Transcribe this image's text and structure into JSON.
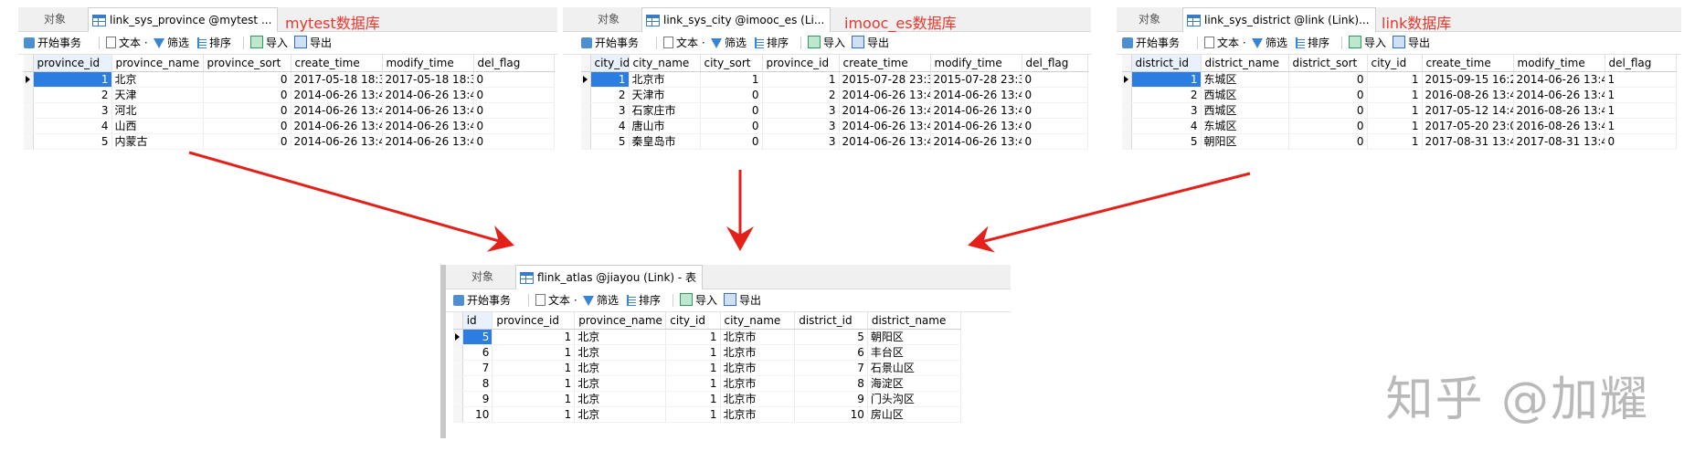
{
  "common": {
    "objects_tab": "对象",
    "toolbar": {
      "begin_tx": "开始事务",
      "text": "文本",
      "filter": "筛选",
      "sort": "排序",
      "import": "导入",
      "export": "导出"
    }
  },
  "watermark": "知乎 @加耀",
  "panels": [
    {
      "tab_title": "link_sys_province @mytest ...",
      "db_label": "mytest数据库",
      "columns": [
        "province_id",
        "province_name",
        "province_sort",
        "create_time",
        "modify_time",
        "del_flag"
      ],
      "rows": [
        [
          "1",
          "北京",
          "0",
          "2017-05-18 18:3(",
          "2017-05-18 18:3(",
          "0"
        ],
        [
          "2",
          "天津",
          "0",
          "2014-06-26 13:4",
          "2014-06-26 13:4",
          "0"
        ],
        [
          "3",
          "河北",
          "0",
          "2014-06-26 13:4",
          "2014-06-26 13:4",
          "0"
        ],
        [
          "4",
          "山西",
          "0",
          "2014-06-26 13:4",
          "2014-06-26 13:4",
          "0"
        ],
        [
          "5",
          "内蒙古",
          "0",
          "2014-06-26 13:4",
          "2014-06-26 13:4",
          "0"
        ]
      ]
    },
    {
      "tab_title": "link_sys_city @imooc_es (Li...",
      "db_label": "imooc_es数据库",
      "columns": [
        "city_id",
        "city_name",
        "city_sort",
        "province_id",
        "create_time",
        "modify_time",
        "del_flag"
      ],
      "rows": [
        [
          "1",
          "北京市",
          "1",
          "1",
          "2015-07-28 23:3",
          "2015-07-28 23:3",
          "0"
        ],
        [
          "2",
          "天津市",
          "0",
          "2",
          "2014-06-26 13:4",
          "2014-06-26 13:4",
          "0"
        ],
        [
          "3",
          "石家庄市",
          "0",
          "3",
          "2014-06-26 13:4",
          "2014-06-26 13:4",
          "0"
        ],
        [
          "4",
          "唐山市",
          "0",
          "3",
          "2014-06-26 13:4",
          "2014-06-26 13:4",
          "0"
        ],
        [
          "5",
          "秦皇岛市",
          "0",
          "3",
          "2014-06-26 13:4",
          "2014-06-26 13:4",
          "0"
        ]
      ]
    },
    {
      "tab_title": "link_sys_district @link (Link)...",
      "db_label": "link数据库",
      "columns": [
        "district_id",
        "district_name",
        "district_sort",
        "city_id",
        "create_time",
        "modify_time",
        "del_flag"
      ],
      "rows": [
        [
          "1",
          "东城区",
          "0",
          "1",
          "2015-09-15 16:2",
          "2014-06-26 13:4",
          "1"
        ],
        [
          "2",
          "西城区",
          "0",
          "1",
          "2016-08-26 13:4",
          "2014-06-26 13:4",
          "1"
        ],
        [
          "3",
          "西城区",
          "0",
          "1",
          "2017-05-12 14:4",
          "2016-08-26 13:4",
          "1"
        ],
        [
          "4",
          "东城区",
          "0",
          "1",
          "2017-05-20 23:0",
          "2016-08-26 13:4",
          "1"
        ],
        [
          "5",
          "朝阳区",
          "0",
          "1",
          "2017-08-31 13:4",
          "2017-08-31 13:4",
          "0"
        ]
      ]
    },
    {
      "tab_title": "flink_atlas @jiayou (Link) - 表",
      "db_label": "",
      "columns": [
        "id",
        "province_id",
        "province_name",
        "city_id",
        "city_name",
        "district_id",
        "district_name"
      ],
      "rows": [
        [
          "5",
          "1",
          "北京",
          "1",
          "北京市",
          "5",
          "朝阳区"
        ],
        [
          "6",
          "1",
          "北京",
          "1",
          "北京市",
          "6",
          "丰台区"
        ],
        [
          "7",
          "1",
          "北京",
          "1",
          "北京市",
          "7",
          "石景山区"
        ],
        [
          "8",
          "1",
          "北京",
          "1",
          "北京市",
          "8",
          "海淀区"
        ],
        [
          "9",
          "1",
          "北京",
          "1",
          "北京市",
          "9",
          "门头沟区"
        ],
        [
          "10",
          "1",
          "北京",
          "1",
          "北京市",
          "10",
          "房山区"
        ]
      ]
    }
  ]
}
